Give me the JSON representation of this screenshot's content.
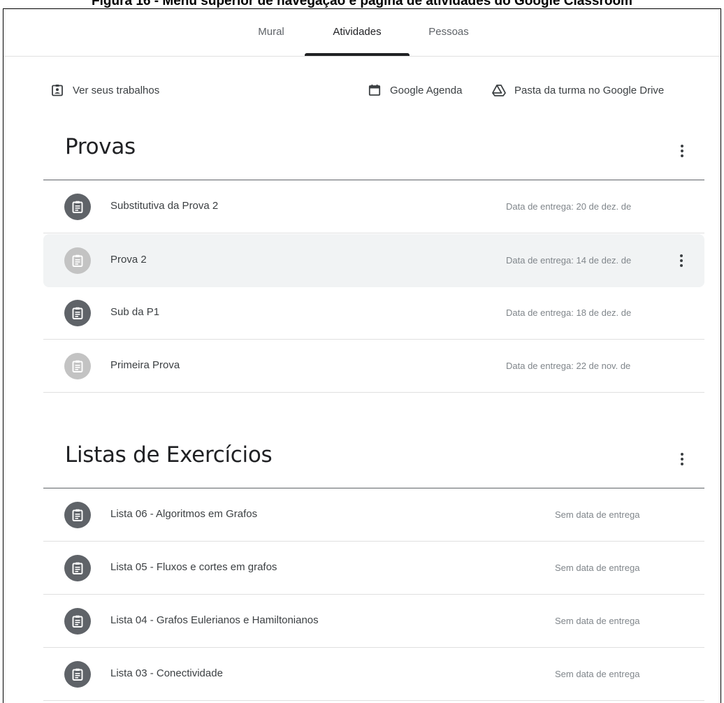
{
  "caption": "Figura 16 - Menu superior de navegação e página de atividades do Google Classroom",
  "tabs": [
    {
      "label": "Mural"
    },
    {
      "label": "Atividades",
      "active": true
    },
    {
      "label": "Pessoas"
    }
  ],
  "actions": {
    "view_work": "Ver seus trabalhos",
    "calendar": "Google Agenda",
    "drive": "Pasta da turma no Google Drive"
  },
  "sections": [
    {
      "title": "Provas",
      "items": [
        {
          "title": "Substitutiva da Prova 2",
          "due": "Data de entrega: 20 de dez. de",
          "icon": "assignment-icon",
          "muted": false
        },
        {
          "title": "Prova 2",
          "due": "Data de entrega: 14 de dez. de",
          "icon": "assignment-icon",
          "muted": true,
          "hovered": true
        },
        {
          "title": "Sub da P1",
          "due": "Data de entrega: 18 de dez. de",
          "icon": "assignment-icon",
          "muted": false
        },
        {
          "title": "Primeira Prova",
          "due": "Data de entrega: 22 de nov. de",
          "icon": "assignment-icon",
          "muted": true
        }
      ]
    },
    {
      "title": "Listas de Exercícios",
      "items": [
        {
          "title": "Lista 06 - Algoritmos em Grafos",
          "due": "Sem data de entrega",
          "icon": "assignment-icon",
          "muted": false
        },
        {
          "title": "Lista 05 - Fluxos e cortes em grafos",
          "due": "Sem data de entrega",
          "icon": "assignment-icon",
          "muted": false
        },
        {
          "title": "Lista 04 - Grafos Eulerianos e Hamiltonianos",
          "due": "Sem data de entrega",
          "icon": "assignment-icon",
          "muted": false
        },
        {
          "title": "Lista 03 - Conectividade",
          "due": "Sem data de entrega",
          "icon": "assignment-icon",
          "muted": false
        }
      ]
    }
  ],
  "colors": {
    "text_primary": "#202124",
    "text_secondary": "#3c4043",
    "text_muted": "#80868b",
    "badge_active": "#5f6368",
    "badge_muted": "#c3c3c3",
    "hover_row": "#f1f3f4"
  }
}
